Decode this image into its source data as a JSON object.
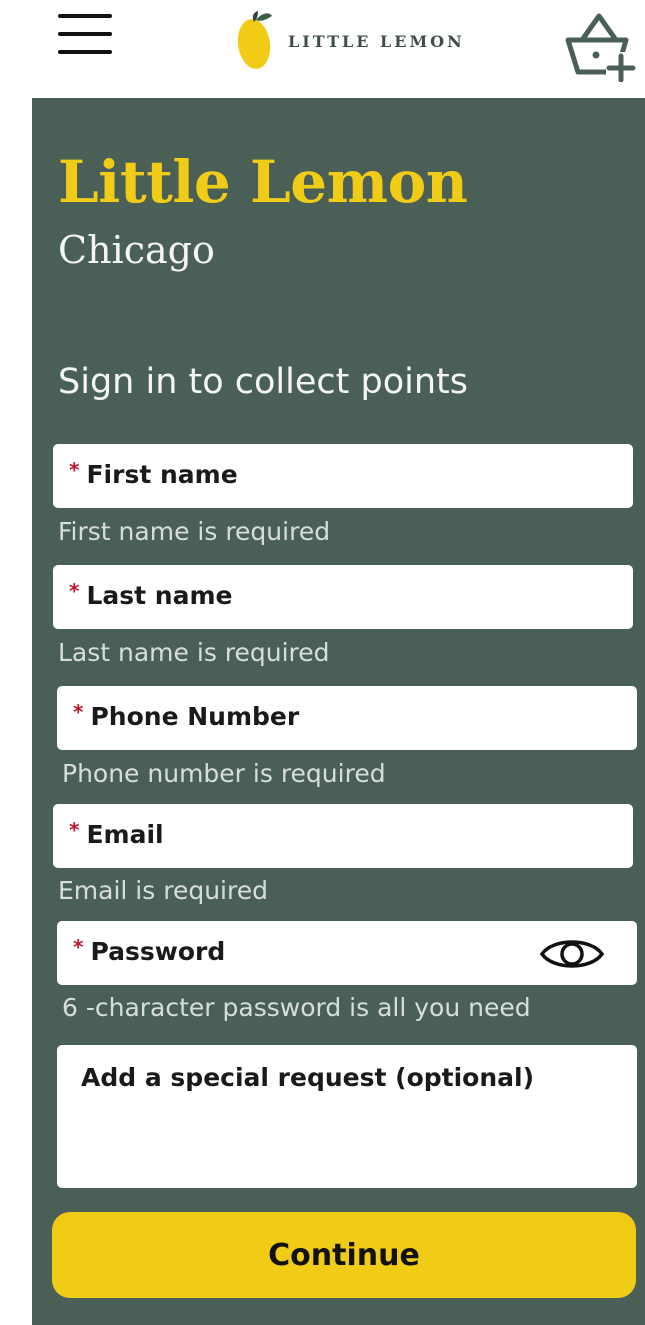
{
  "header": {
    "logo_text": "LITTLE LEMON"
  },
  "hero": {
    "title": "Little Lemon",
    "subtitle": "Chicago"
  },
  "form": {
    "heading": "Sign in to collect points",
    "required_marker": "*",
    "fields": [
      {
        "label": "First name",
        "helper": "First name is required",
        "required": true
      },
      {
        "label": "Last name",
        "helper": "Last name is required",
        "required": true
      },
      {
        "label": "Phone Number",
        "helper": "Phone number is required",
        "required": true
      },
      {
        "label": "Email",
        "helper": "Email is required",
        "required": true
      },
      {
        "label": "Password",
        "helper": "6 -character password is all you need",
        "required": true
      }
    ],
    "special_request_placeholder": "Add a special request (optional)",
    "continue_label": "Continue"
  },
  "icons": {
    "menu": "hamburger-menu-icon",
    "logo": "lemon-icon",
    "basket": "basket-add-icon",
    "password_toggle": "eye-icon"
  },
  "colors": {
    "panel_bg": "#4a5f56",
    "brand_yellow": "#f1cc17",
    "required_red": "#c0162c"
  }
}
